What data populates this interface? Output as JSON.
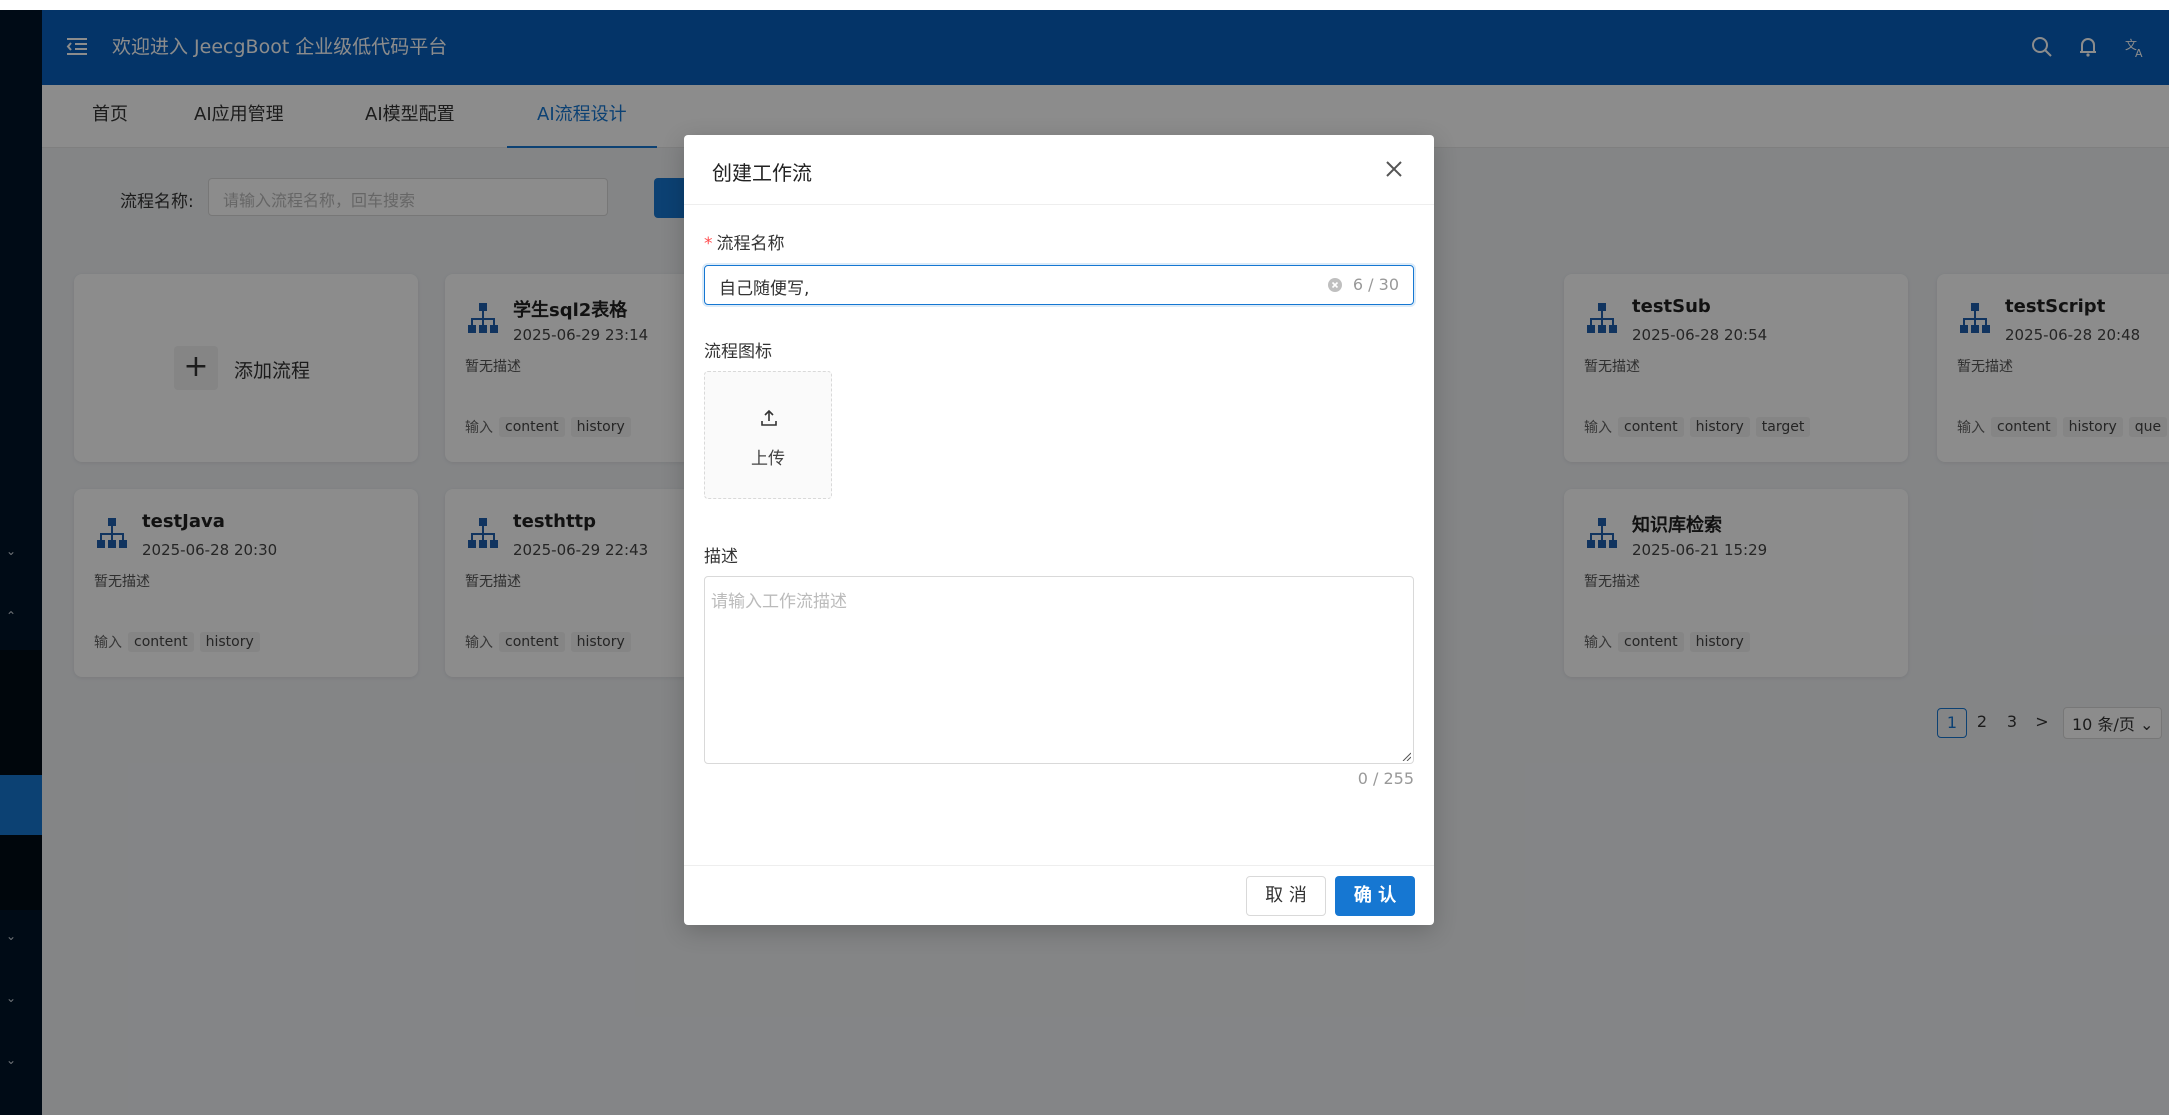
{
  "header": {
    "title": "欢迎进入 JeecgBoot 企业级低代码平台",
    "icons": [
      "menu-toggle-icon",
      "search-icon",
      "bell-icon",
      "translate-icon"
    ]
  },
  "tabs": [
    {
      "label": "首页"
    },
    {
      "label": "AI应用管理"
    },
    {
      "label": "AI模型配置"
    },
    {
      "label": "AI流程设计"
    }
  ],
  "search": {
    "label": "流程名称:",
    "placeholder": "请输入流程名称，回车搜索"
  },
  "add_card": {
    "label": "添加流程"
  },
  "cards": [
    {
      "name": "学生sql2表格",
      "date": "2025-06-29 23:14",
      "desc": "暂无描述",
      "inputs_label": "输入",
      "tags": [
        "content",
        "history"
      ]
    },
    {
      "name": "testSub",
      "date": "2025-06-28 20:54",
      "desc": "暂无描述",
      "inputs_label": "输入",
      "tags": [
        "content",
        "history",
        "target"
      ]
    },
    {
      "name": "testScript",
      "date": "2025-06-28 20:48",
      "desc": "暂无描述",
      "inputs_label": "输入",
      "tags": [
        "content",
        "history",
        "que"
      ]
    },
    {
      "name": "testJava",
      "date": "2025-06-28 20:30",
      "desc": "暂无描述",
      "inputs_label": "输入",
      "tags": [
        "content",
        "history"
      ]
    },
    {
      "name": "testhttp",
      "date": "2025-06-29 22:43",
      "desc": "暂无描述",
      "inputs_label": "输入",
      "tags": [
        "content",
        "history"
      ]
    },
    {
      "name": "知识库检索",
      "date": "2025-06-21 15:29",
      "desc": "暂无描述",
      "inputs_label": "输入",
      "tags": [
        "content",
        "history"
      ]
    }
  ],
  "pagination": {
    "pages": [
      "1",
      "2",
      "3"
    ],
    "current": "1",
    "next": ">",
    "page_size": "10 条/页"
  },
  "modal": {
    "title": "创建工作流",
    "name_label": "流程名称",
    "required_mark": "*",
    "name_value": "自己随便写,",
    "name_counter": "6 / 30",
    "icon_label": "流程图标",
    "upload_label": "上传",
    "desc_label": "描述",
    "desc_placeholder": "请输入工作流描述",
    "desc_counter": "0 / 255",
    "cancel_label": "取 消",
    "ok_label": "确 认"
  },
  "colors": {
    "header_bg": "#0960bd",
    "sidebar_bg": "#001529",
    "primary": "#1677d2",
    "required": "#ff4d4f"
  }
}
